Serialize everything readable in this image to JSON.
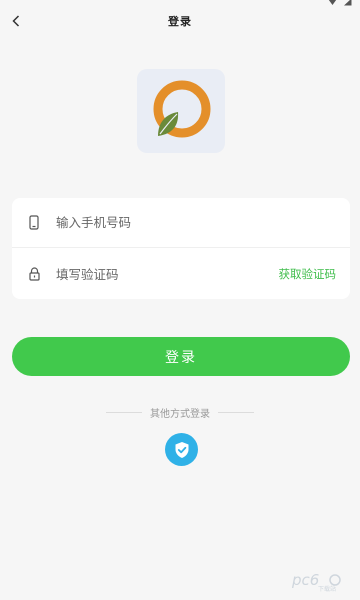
{
  "nav": {
    "title": "登录",
    "back_icon": "chevron-left-icon"
  },
  "logo": {
    "icon": "app-logo-icon",
    "colors": {
      "ring": "#e48f2a",
      "leaf": "#6a8a3a",
      "background": "#e9edf5"
    }
  },
  "form": {
    "phone": {
      "placeholder": "输入手机号码",
      "icon": "phone-icon",
      "value": ""
    },
    "code": {
      "placeholder": "填写验证码",
      "icon": "lock-icon",
      "value": ""
    },
    "get_code_label": "获取验证码"
  },
  "login_button": {
    "label": "登录"
  },
  "other_login": {
    "label": "其他方式登录",
    "option_icon": "shield-check-icon"
  },
  "colors": {
    "accent_green": "#41c94c",
    "link_green": "#3fbd4b",
    "shield_blue": "#2fb1e7",
    "background": "#f6f6f6"
  }
}
